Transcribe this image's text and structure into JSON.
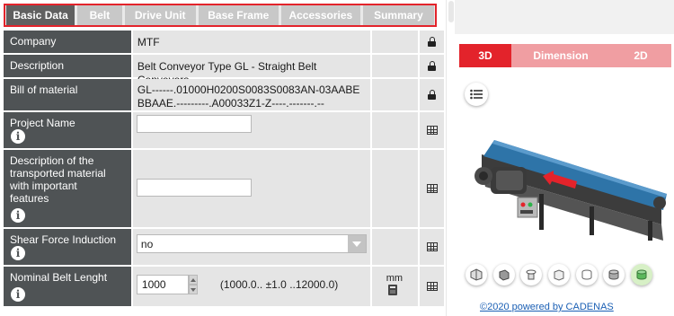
{
  "tabs": [
    {
      "label": "Basic Data",
      "active": true
    },
    {
      "label": "Belt",
      "active": false
    },
    {
      "label": "Drive Unit",
      "active": false
    },
    {
      "label": "Base Frame",
      "active": false
    },
    {
      "label": "Accessories",
      "active": false
    },
    {
      "label": "Summary",
      "active": false
    }
  ],
  "form": {
    "company": {
      "label": "Company",
      "value": "MTF",
      "action_icon": "lock-icon"
    },
    "description": {
      "label": "Description",
      "value": "Belt Conveyor Type GL - Straight Belt Conveyors",
      "action_icon": "lock-icon"
    },
    "bill_of_material": {
      "label": "Bill of material",
      "value": "GL------.01000H0200S0083S0083AN-03AABEBBAAE.---------.A00033Z1-Z----.-------.--",
      "action_icon": "lock-icon"
    },
    "project_name": {
      "label": "Project Name",
      "value": "",
      "action_icon": "table-icon",
      "info_icon": "info-icon"
    },
    "transported_material": {
      "label": "Description of the transported material with important features",
      "value": "",
      "action_icon": "table-icon",
      "info_icon": "info-icon"
    },
    "shear_force": {
      "label": "Shear Force Induction",
      "value": "no",
      "action_icon": "table-icon",
      "info_icon": "info-icon"
    },
    "belt_length": {
      "label": "Nominal Belt Lenght",
      "value": "1000",
      "range": "(1000.0.. ±1.0 ..12000.0)",
      "unit": "mm",
      "unit_icon": "calculator-icon",
      "action_icon": "table-icon",
      "info_icon": "info-icon"
    }
  },
  "viewer": {
    "tabs": [
      {
        "label": "3D",
        "active": true
      },
      {
        "label": "Dimension",
        "active": false
      },
      {
        "label": "2D",
        "active": false
      }
    ],
    "list_button_icon": "list-icon",
    "view_icons": [
      "isometric-view-icon",
      "shaded-view-icon",
      "rotate-view-icon",
      "box-view-icon",
      "cylinder-wireframe-icon",
      "cylinder-shaded-icon",
      "cylinder-color-icon"
    ],
    "powered_by": "©2020 powered by CADENAS",
    "colors": {
      "accent": "#e3232b",
      "accent_light": "#f09ea2",
      "label_bg": "#4f5355",
      "belt": "#2e74a8"
    }
  }
}
